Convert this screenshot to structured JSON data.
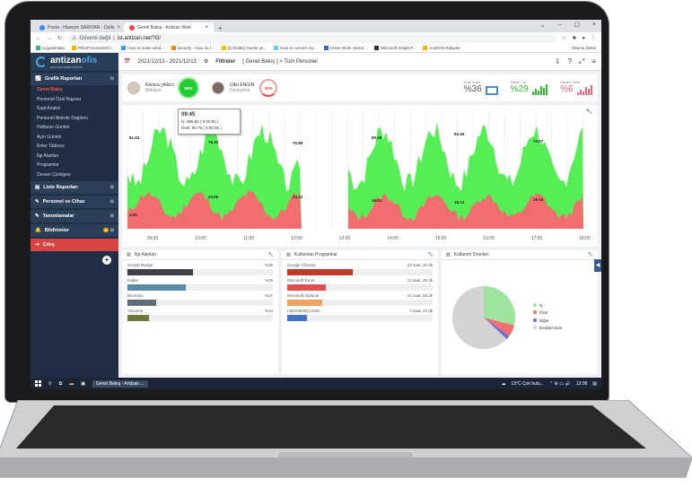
{
  "browser": {
    "tabs": [
      {
        "label": "Posta - Hüseyin SARIYAR - Outlo"
      },
      {
        "label": "Genel Bakış - Antizan Web"
      }
    ],
    "new_tab": "+",
    "url_warning": "Güvenli değil",
    "url": "ist.antizan.net/?G/",
    "bookmarks": [
      "Uygulamalar",
      "PillarProcessStrCl...",
      "How to make wind...",
      "security - How do I...",
      "[Çözüldü] Günler yit...",
      "How to convert my...",
      "Home Work Vector...",
      "Microsoft Graph P...",
      "AntiZAN Rakipler",
      "Okuma listesi"
    ]
  },
  "sidebar": {
    "logo_name_a": "antizan",
    "logo_name_b": "ofis",
    "logo_sub": "personel analiz sistemi",
    "sections": [
      {
        "label": "Grafik Raporları",
        "items": [
          "Genel Bakış",
          "Personel Özel Raporu",
          "Saat Analizi",
          "Personel Aktivite Dağılımı",
          "Haftanın Günleri",
          "Ayın Günleri",
          "Enter Tablosu",
          "İlgi Alanları",
          "Programlar",
          "Devam Çizelgesi"
        ]
      },
      {
        "label": "Liste Raporları"
      },
      {
        "label": "Personel ve Cihaz"
      },
      {
        "label": "Tanımlamalar"
      },
      {
        "label": "Bildirimler",
        "badge": "6"
      },
      {
        "label": "Çıkış"
      }
    ]
  },
  "topbar": {
    "date_range": "2021/12/13 - 2021/12/13",
    "filters": "Filtreler",
    "breadcrumb": "[ Genel Bakış ] > Tüm Personel"
  },
  "summary": {
    "person1": {
      "name": "Karaca yildizci",
      "status": "Bekliyor",
      "percent": "88%"
    },
    "person2": {
      "name": "Ülkü ENGIN",
      "status": "Deneyime",
      "percent": "35%"
    },
    "kpis": [
      {
        "title": "Kulll Oranı",
        "value": "%36"
      },
      {
        "title": "Genel / İş",
        "value": "%29"
      },
      {
        "title": "Genel / Özel",
        "value": "%6"
      }
    ]
  },
  "tooltip": {
    "time": "09:45",
    "line1": "İş: 985.82 ( 0:00:50 )",
    "line2": "Özel: 90.75 ( 0:00:05 )"
  },
  "chart_data": {
    "type": "area",
    "x": [
      "09:00",
      "10:00",
      "11:00",
      "12:00",
      "13:00",
      "14:00",
      "15:00",
      "16:00",
      "17:00",
      "18:00"
    ],
    "series": [
      {
        "name": "İş",
        "color": "#55ee55"
      },
      {
        "name": "Özel",
        "color": "#f26d6d"
      }
    ],
    "labels": [
      "81.53",
      "76.32",
      "75.89",
      "80.28",
      "83.45",
      "74.97",
      "23.06",
      "23.12",
      "19.01",
      "16.12",
      "19.16",
      "4.55"
    ]
  },
  "panels": {
    "interests": {
      "title": "İlgi Alanları",
      "rows": [
        {
          "label": "Sosyal Medya",
          "value": "%39",
          "pct": 39,
          "color": "#3d4147"
        },
        {
          "label": "Haber",
          "value": "%35",
          "pct": 35,
          "color": "#5a8aa6"
        },
        {
          "label": "Ekonomi",
          "value": "%17",
          "pct": 17,
          "color": "#5f6d7b"
        },
        {
          "label": "Alışveriş",
          "value": "%13",
          "pct": 13,
          "color": "#6b7a3c"
        }
      ]
    },
    "programs": {
      "title": "Kullanılan Programlar",
      "rows": [
        {
          "label": "Google Chrome",
          "value": "23 saat, 26 dk",
          "pct": 39,
          "color": "#c0392b"
        },
        {
          "label": "Microsoft Excel",
          "value": "13 saat, 45 dk",
          "pct": 23,
          "color": "#e05050"
        },
        {
          "label": "Microsoft Outlook",
          "value": "12 saat, 55 dk",
          "pct": 21,
          "color": "#f0a060"
        },
        {
          "label": "LMAINENG2.EXE",
          "value": "7 saat, 22 dk",
          "pct": 12,
          "color": "#4472c4"
        }
      ]
    },
    "usage": {
      "title": "Kullanım Oranları",
      "legend": [
        {
          "label": "İş",
          "color": "#9ee39e",
          "pct": 29
        },
        {
          "label": "Özel",
          "color": "#f07070",
          "pct": 6
        },
        {
          "label": "Diğer",
          "color": "#6b6bdc",
          "pct": 2
        },
        {
          "label": "Boştaki Süre",
          "color": "#d3d3d3",
          "pct": 63
        }
      ]
    }
  },
  "taskbar": {
    "app": "Genel Bakış - Antizan ...",
    "weather": "13°C Çok bulu...",
    "time": "12:08"
  }
}
